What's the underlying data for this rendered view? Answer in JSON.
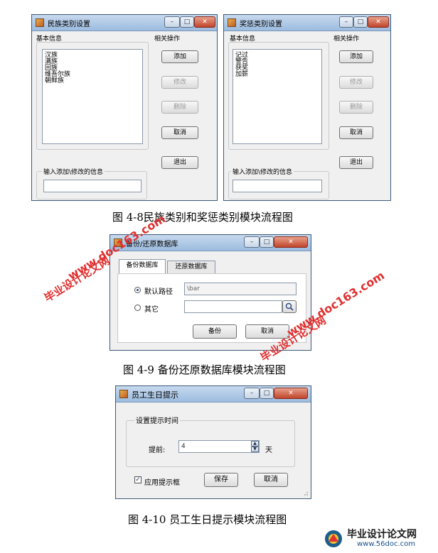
{
  "fig1": {
    "left_window": {
      "title": "民族类别设置",
      "basic_info_label": "基本信息",
      "related_ops_label": "相关操作",
      "items": [
        "汉族",
        "满族",
        "回族",
        "维吾尔族",
        "朝鲜族"
      ],
      "add": "添加",
      "modify": "修改",
      "delete": "删除",
      "cancel": "取消",
      "exit": "退出",
      "input_label": "输入添加\\修改的信息"
    },
    "right_window": {
      "title": "奖惩类别设置",
      "basic_info_label": "基本信息",
      "related_ops_label": "相关操作",
      "items": [
        "记过",
        "警告",
        "获奖",
        "加薪"
      ],
      "add": "添加",
      "modify": "修改",
      "delete": "删除",
      "cancel": "取消",
      "exit": "退出",
      "input_label": "输入添加\\修改的信息"
    },
    "caption": "图 4-8民族类别和奖惩类别模块流程图"
  },
  "fig2": {
    "window_title": "备份/还原数据库",
    "tab_backup": "备份数据库",
    "tab_restore": "还原数据库",
    "default_path_label": "默认路径",
    "default_path_value": "\\bar",
    "other_label": "其它",
    "backup_button": "备份",
    "cancel_button": "取消",
    "caption": "图 4-9 备份还原数据库模块流程图"
  },
  "fig3": {
    "window_title": "员工生日提示",
    "group_label": "设置提示时间",
    "advance_label": "提前:",
    "advance_value": "4",
    "unit_label": "天",
    "apply_checkbox_label": "应用提示框",
    "save_button": "保存",
    "cancel_button": "取消",
    "caption": "图 4-10 员工生日提示模块流程图"
  },
  "watermarks": {
    "url": "www.doc163.com",
    "site_name": "毕业设计论文网",
    "bottom_site": "毕业设计论文网",
    "bottom_url": "www.56doc.com"
  },
  "colors": {
    "watermark_red": "#e03030",
    "titlebar": "#9cbcdf",
    "close_button": "#c0452b"
  }
}
